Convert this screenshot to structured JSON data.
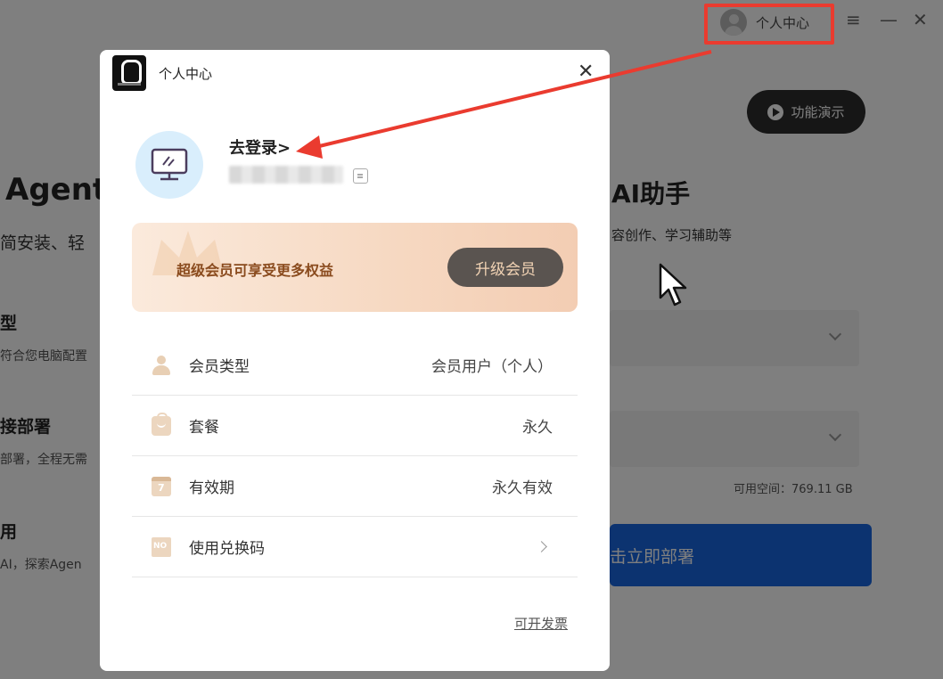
{
  "background": {
    "titlebar": {
      "user_center_label": "个人中心",
      "menu_icon": "≡",
      "minimize_icon": "—",
      "close_icon": "✕"
    },
    "demo_button_label": "功能演示",
    "hero_left": "Agent",
    "hero_right": "AI助手",
    "sub_left": "简安装、轻",
    "sub_right": "容创作、学习辅助等",
    "features": [
      {
        "title": "型",
        "desc": "符合您电脑配置"
      },
      {
        "title": "接部署",
        "desc": "部署，全程无需"
      },
      {
        "title": "用",
        "desc": "AI，探索Agen"
      }
    ],
    "space_text": "可用空间：769.11 GB",
    "deploy_button_label": "击立即部署"
  },
  "modal": {
    "title": "个人中心",
    "close_icon": "✕",
    "login_link": "去登录>",
    "vip_banner_text": "超级会员可享受更多权益",
    "upgrade_button": "升级会员",
    "rows": [
      {
        "label": "会员类型",
        "value": "会员用户（个人）",
        "icon": "user-icon"
      },
      {
        "label": "套餐",
        "value": "永久",
        "icon": "bag-icon"
      },
      {
        "label": "有效期",
        "value": "永久有效",
        "icon": "calendar-icon"
      },
      {
        "label": "使用兑换码",
        "value": "",
        "icon": "code-icon"
      }
    ],
    "invoice_link": "可开发票"
  },
  "colors": {
    "annotation_red": "#ea3b2f",
    "deploy_blue": "#1867e0",
    "vip_text": "#8a4b1e"
  }
}
